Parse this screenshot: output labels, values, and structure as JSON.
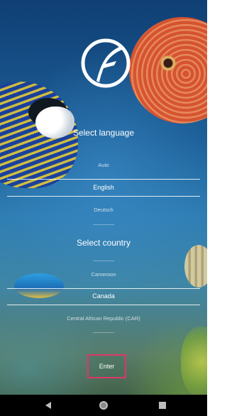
{
  "language": {
    "title": "Select language",
    "options": [
      "Auto",
      "English",
      "Deutsch"
    ],
    "selected": "English"
  },
  "country": {
    "title": "Select country",
    "options": [
      "Cameroon",
      "Canada",
      "Central African Republic (CAR)"
    ],
    "selected": "Canada"
  },
  "enter_button": {
    "label": "Enter",
    "highlight_color": "#e0356a"
  },
  "navbar": {
    "icons": [
      "back-icon",
      "home-icon",
      "recent-apps-icon"
    ]
  },
  "colors": {
    "text": "#ffffff",
    "navbar": "#000000"
  }
}
